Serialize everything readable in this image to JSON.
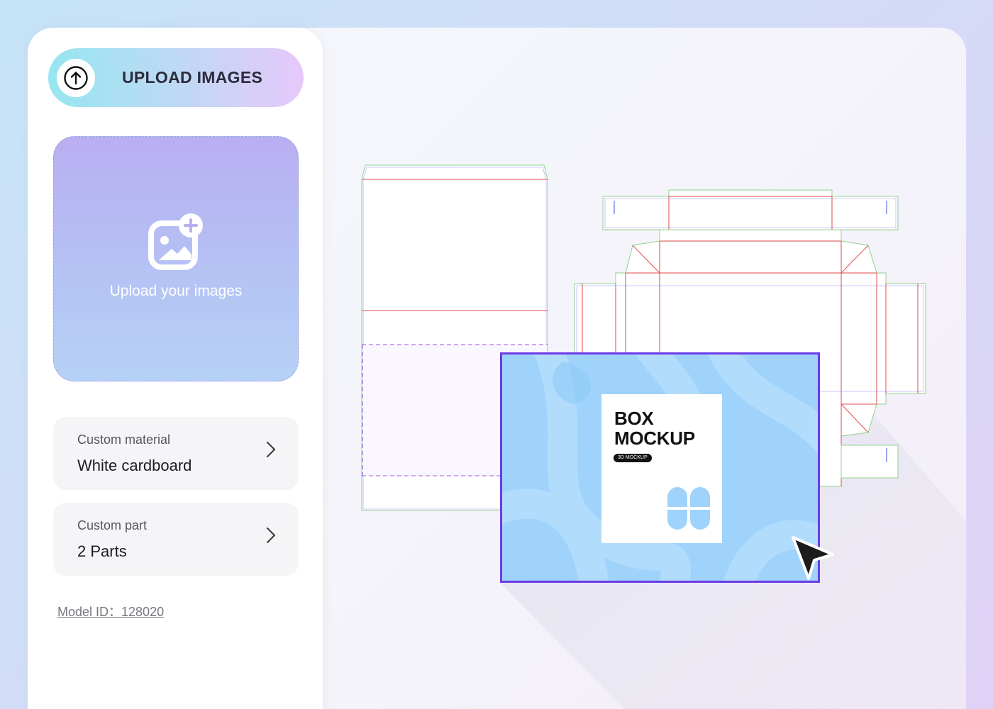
{
  "sidebar": {
    "upload_button_label": "UPLOAD IMAGES",
    "upload_icon": "arrow-up-circle-icon",
    "dropzone": {
      "text": "Upload your images",
      "icon": "add-image-icon"
    },
    "options": [
      {
        "caption": "Custom material",
        "value": "White cardboard",
        "icon": "chevron-right-icon"
      },
      {
        "caption": "Custom part",
        "value": "2 Parts",
        "icon": "chevron-right-icon"
      }
    ],
    "model_id": "Model ID：128020"
  },
  "preview": {
    "mockup_title_line1": "BOX",
    "mockup_title_line2": "MOCKUP",
    "mockup_tag": "3D MOCKUP",
    "selection_color": "#6c3be6",
    "cut_line_color": "#e24a4a",
    "fold_line_color": "#8fd18f",
    "cursor_icon": "pointer-arrow-icon"
  }
}
